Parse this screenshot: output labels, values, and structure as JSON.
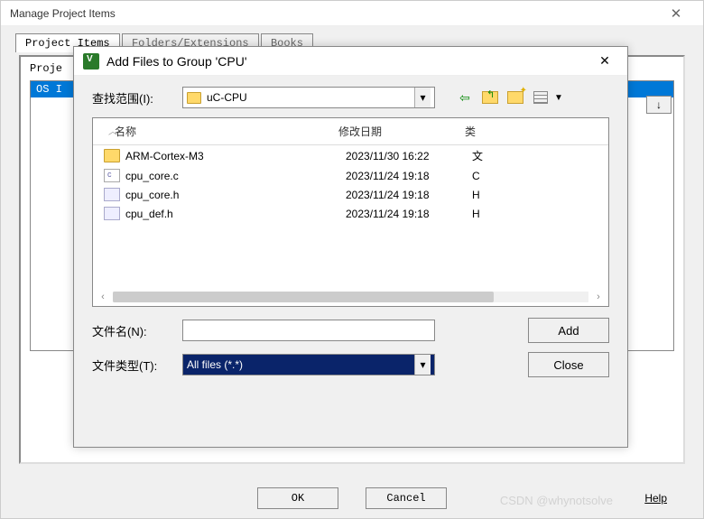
{
  "outer": {
    "title": "Manage Project Items",
    "tabs": [
      "Project Items",
      "Folders/Extensions",
      "Books"
    ],
    "project_header": "Proje",
    "project_item": "OS I",
    "buttons": {
      "ok": "OK",
      "cancel": "Cancel",
      "help": "Help"
    }
  },
  "dialog": {
    "title": "Add Files to Group 'CPU'",
    "look_in_label": "查找范围(I):",
    "look_in_value": "uC-CPU",
    "columns": {
      "name": "名称",
      "date": "修改日期",
      "type": "类"
    },
    "files": [
      {
        "name": "ARM-Cortex-M3",
        "date": "2023/11/30 16:22",
        "type": "文",
        "kind": "folder"
      },
      {
        "name": "cpu_core.c",
        "date": "2023/11/24 19:18",
        "type": "C ",
        "kind": "c"
      },
      {
        "name": "cpu_core.h",
        "date": "2023/11/24 19:18",
        "type": "H ",
        "kind": "h"
      },
      {
        "name": "cpu_def.h",
        "date": "2023/11/24 19:18",
        "type": "H ",
        "kind": "h"
      }
    ],
    "filename_label": "文件名(N):",
    "filename_value": "",
    "filetype_label": "文件类型(T):",
    "filetype_value": "All files (*.*)",
    "add": "Add",
    "close": "Close"
  },
  "watermark": "CSDN @whynotsolve"
}
